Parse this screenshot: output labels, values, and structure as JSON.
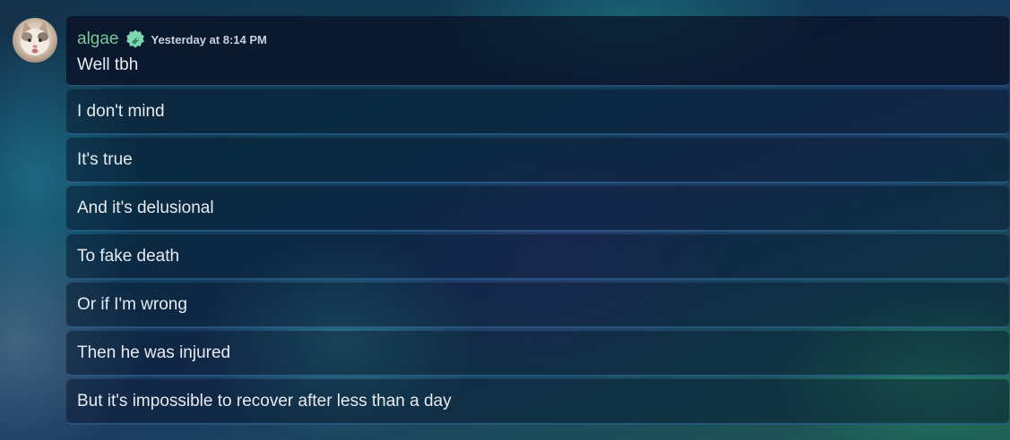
{
  "message": {
    "author": {
      "username": "algae",
      "name_color": "#7ec597",
      "avatar_icon": "cat-avatar",
      "badge_icon": "green-tag-badge"
    },
    "timestamp": "Yesterday at 8:14 PM",
    "lines": [
      "Well tbh",
      "I don't mind",
      "It's true",
      "And it's delusional",
      "To fake death",
      "Or if I'm wrong",
      "Then he was injured",
      "But it's impossible to recover after less than a day"
    ]
  }
}
